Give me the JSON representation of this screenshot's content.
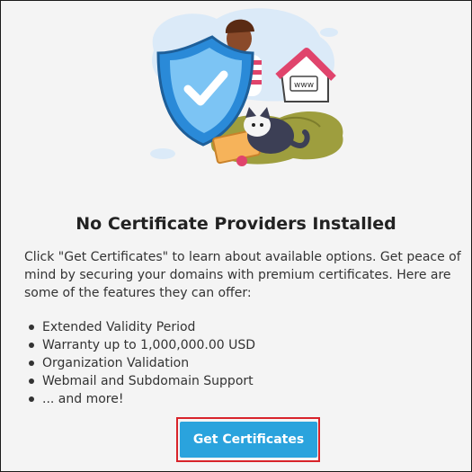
{
  "empty_state": {
    "illustration": "certificate-shield-illustration",
    "title": "No Certificate Providers Installed",
    "description": "Click \"Get Certificates\" to learn about available options. Get peace of mind by securing your domains with premium certificates. Here are some of the features they can offer:",
    "features": [
      "Extended Validity Period",
      "Warranty up to 1,000,000.00 USD",
      "Organization Validation",
      "Webmail and Subdomain Support",
      "... and more!"
    ],
    "button_label": "Get Certificates",
    "www_badge": "www"
  },
  "colors": {
    "button": "#2aa3dd",
    "highlight": "#d8232a",
    "background": "#f4f4f4"
  }
}
